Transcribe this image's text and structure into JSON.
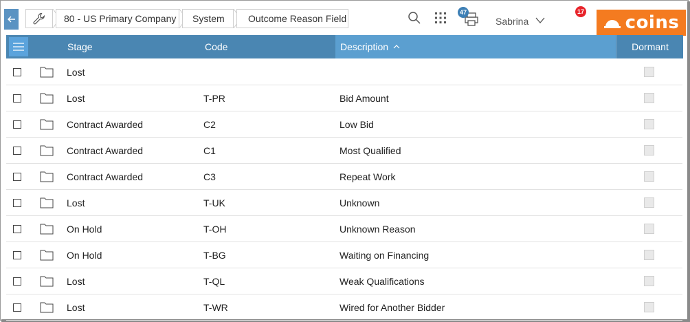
{
  "breadcrumbs": {
    "company": "80 - US Primary Company",
    "section": "System",
    "page": "Outcome Reason Field"
  },
  "header": {
    "print_badge": "47",
    "user_name": "Sabrina",
    "notification_badge": "17",
    "logo_text": "coins"
  },
  "table": {
    "columns": {
      "stage": "Stage",
      "code": "Code",
      "description": "Description",
      "dormant": "Dormant"
    },
    "rows": [
      {
        "stage": "Lost",
        "code": "",
        "description": ""
      },
      {
        "stage": "Lost",
        "code": "T-PR",
        "description": "Bid Amount"
      },
      {
        "stage": "Contract Awarded",
        "code": "C2",
        "description": "Low Bid"
      },
      {
        "stage": "Contract Awarded",
        "code": "C1",
        "description": "Most Qualified"
      },
      {
        "stage": "Contract Awarded",
        "code": "C3",
        "description": "Repeat Work"
      },
      {
        "stage": "Lost",
        "code": "T-UK",
        "description": "Unknown"
      },
      {
        "stage": "On Hold",
        "code": "T-OH",
        "description": "Unknown Reason"
      },
      {
        "stage": "On Hold",
        "code": "T-BG",
        "description": "Waiting on Financing"
      },
      {
        "stage": "Lost",
        "code": "T-QL",
        "description": "Weak Qualifications"
      },
      {
        "stage": "Lost",
        "code": "T-WR",
        "description": "Wired for Another Bidder"
      }
    ]
  },
  "colors": {
    "header_bg": "#4a86b2",
    "sorted_header_bg": "#5b9fd0",
    "logo_bg": "#f47b20",
    "badge_blue": "#3d7fb5",
    "badge_red": "#e8242b"
  }
}
